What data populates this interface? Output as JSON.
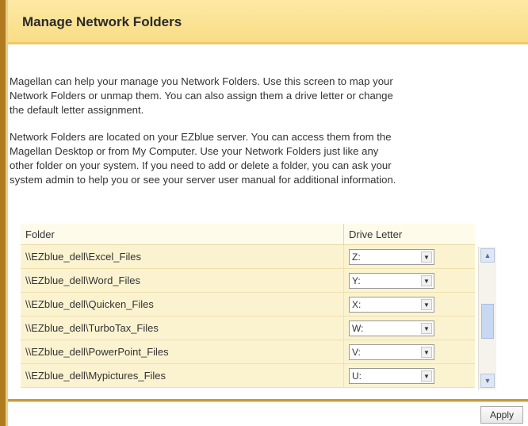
{
  "page": {
    "title": "Manage Network Folders"
  },
  "description": {
    "paragraph1": "Magellan can help your manage you Network Folders. Use this screen to map your\nNetwork Folders or unmap them. You can also assign them a drive letter or change\nthe default letter assignment.",
    "paragraph2": "Network Folders are located on your EZblue server. You can access them from the\nMagellan Desktop or from My Computer. Use your Network Folders just like any\nother folder on your system. If you need to add or delete a folder, you can ask your\nsystem admin to help you or see your server user manual for additional information."
  },
  "table": {
    "headers": {
      "folder": "Folder",
      "drive_letter": "Drive Letter"
    },
    "rows": [
      {
        "folder": "\\\\EZblue_dell\\Excel_Files",
        "drive": "Z:"
      },
      {
        "folder": "\\\\EZblue_dell\\Word_Files",
        "drive": "Y:"
      },
      {
        "folder": "\\\\EZblue_dell\\Quicken_Files",
        "drive": "X:"
      },
      {
        "folder": "\\\\EZblue_dell\\TurboTax_Files",
        "drive": "W:"
      },
      {
        "folder": "\\\\EZblue_dell\\PowerPoint_Files",
        "drive": "V:"
      },
      {
        "folder": "\\\\EZblue_dell\\Mypictures_Files",
        "drive": "U:"
      }
    ]
  },
  "icons": {
    "dropdown": "chevron-down-icon",
    "scroll_up": "scroll-up-arrow-icon",
    "scroll_down": "scroll-down-arrow-icon"
  },
  "buttons": {
    "apply": "Apply"
  },
  "colors": {
    "accent": "#b07a1e",
    "header_bg": "#f8dd85",
    "row_bg": "#fbf3d0"
  }
}
